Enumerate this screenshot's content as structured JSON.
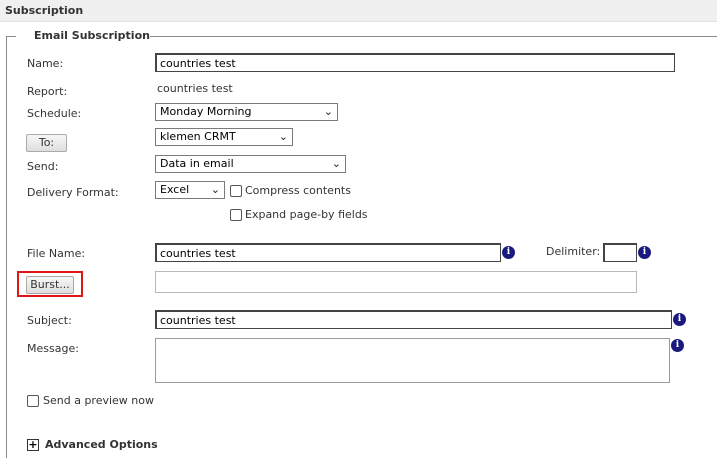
{
  "title": "Subscription",
  "legend": "Email Subscription",
  "labels": {
    "name": "Name:",
    "report": "Report:",
    "schedule": "Schedule:",
    "send": "Send:",
    "delivery_format": "Delivery Format:",
    "file_name": "File Name:",
    "delimiter": "Delimiter:",
    "subject": "Subject:",
    "message": "Message:"
  },
  "fields": {
    "name": "countries test",
    "report": "countries test",
    "schedule": "Monday Morning",
    "to_recipient": "klemen CRMT",
    "send": "Data in email",
    "delivery_format": "Excel",
    "file_name": "countries test",
    "delimiter": "",
    "burst": "",
    "subject": "countries test",
    "message": ""
  },
  "buttons": {
    "to": "To:",
    "burst": "Burst..."
  },
  "checkboxes": {
    "compress": "Compress contents",
    "expand": "Expand page-by fields",
    "preview": "Send a preview now"
  },
  "advanced": {
    "expand_symbol": "+",
    "label": "Advanced Options"
  },
  "icons": {
    "info": "i",
    "chevron": "⌄"
  },
  "colors": {
    "highlight": "#e01515",
    "info_icon": "#1a1a7e"
  }
}
